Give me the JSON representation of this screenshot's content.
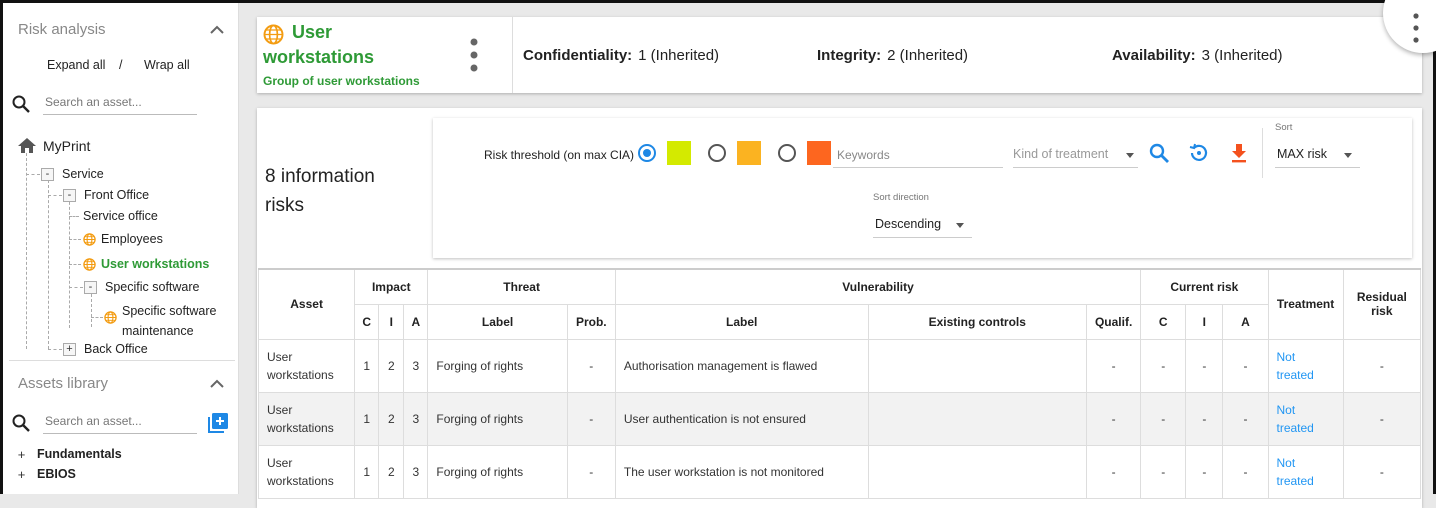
{
  "sidebar": {
    "risk_title": "Risk analysis",
    "expand_all": "Expand all",
    "separator": "/",
    "wrap_all": "Wrap all",
    "search_placeholder": "Search an asset...",
    "tree": {
      "root": "MyPrint",
      "service": "Service",
      "front_office": "Front Office",
      "service_office": "Service office",
      "employees": "Employees",
      "user_workstations": "User workstations",
      "specific_software": "Specific software",
      "specific_software_maintenance_1": "Specific software",
      "specific_software_maintenance_2": "maintenance",
      "back_office": "Back Office"
    },
    "library_title": "Assets library",
    "library_search_placeholder": "Search an asset...",
    "library_items": [
      "Fundamentals",
      "EBIOS"
    ]
  },
  "header": {
    "title_line1": "User",
    "title_line2": "workstations",
    "subtitle": "Group of user workstations",
    "confidentiality_label": "Confidentiality:",
    "confidentiality_value": "1 (Inherited)",
    "integrity_label": "Integrity:",
    "integrity_value": "2 (Inherited)",
    "availability_label": "Availability:",
    "availability_value": "3 (Inherited)"
  },
  "main": {
    "count_line1": "8 information",
    "count_line2": "risks",
    "filters": {
      "threshold_label": "Risk threshold (on max CIA)",
      "swatch_colors": [
        "#d4ea00",
        "#fbb321",
        "#fd661f"
      ],
      "keywords_placeholder": "Keywords",
      "kind_of_treatment_placeholder": "Kind of treatment",
      "sort_label": "Sort",
      "sort_value": "MAX risk",
      "sort_direction_label": "Sort direction",
      "sort_direction_value": "Descending"
    },
    "table": {
      "headers": {
        "asset": "Asset",
        "impact": "Impact",
        "threat": "Threat",
        "vulnerability": "Vulnerability",
        "current_risk": "Current risk",
        "treatment": "Treatment",
        "residual_line1": "Residual",
        "residual_line2": "risk",
        "c": "C",
        "i": "I",
        "a": "A",
        "label": "Label",
        "prob": "Prob.",
        "vlabel": "Label",
        "existing_controls": "Existing controls",
        "qualif": "Qualif."
      },
      "rows": [
        {
          "asset1": "User",
          "asset2": "workstations",
          "c": "1",
          "i": "2",
          "a": "3",
          "threat": "Forging of rights",
          "prob": "-",
          "vuln": "Authorisation management is flawed",
          "controls": "",
          "qualif": "-",
          "rc": "-",
          "ri": "-",
          "ra": "-",
          "treat1": "Not",
          "treat2": "treated",
          "residual": "-"
        },
        {
          "asset1": "User",
          "asset2": "workstations",
          "c": "1",
          "i": "2",
          "a": "3",
          "threat": "Forging of rights",
          "prob": "-",
          "vuln": "User authentication is not ensured",
          "controls": "",
          "qualif": "-",
          "rc": "-",
          "ri": "-",
          "ra": "-",
          "treat1": "Not",
          "treat2": "treated",
          "residual": "-"
        },
        {
          "asset1": "User",
          "asset2": "workstations",
          "c": "1",
          "i": "2",
          "a": "3",
          "threat": "Forging of rights",
          "prob": "-",
          "vuln": "The user workstation is not monitored",
          "controls": "",
          "qualif": "-",
          "rc": "-",
          "ri": "-",
          "ra": "-",
          "treat1": "Not",
          "treat2": "treated",
          "residual": "-"
        }
      ]
    }
  },
  "colors": {
    "accent_green": "#2e9a36",
    "link_blue": "#2196f3",
    "icon_blue": "#1e88e5",
    "globe_orange": "#f39c12",
    "download_orange": "#f4511e"
  }
}
